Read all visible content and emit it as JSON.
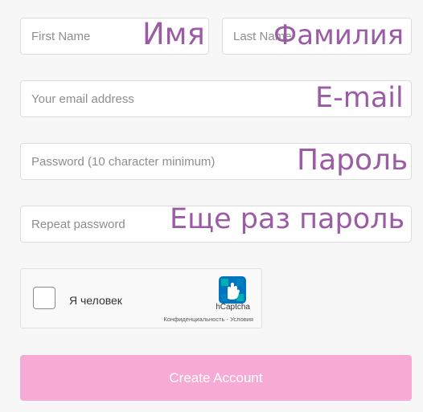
{
  "form": {
    "first_name": {
      "placeholder": "First Name",
      "value": ""
    },
    "last_name": {
      "placeholder": "Last Name",
      "value": ""
    },
    "email": {
      "placeholder": "Your email address",
      "value": ""
    },
    "password": {
      "placeholder": "Password (10 character minimum)",
      "value": ""
    },
    "repeat_password": {
      "placeholder": "Repeat password",
      "value": ""
    },
    "submit_label": "Create Account"
  },
  "annotations": {
    "first_name": "Имя",
    "last_name": "Фамилия",
    "email": "E-mail",
    "password": "Пароль",
    "repeat_password": "Еще раз пароль"
  },
  "captcha": {
    "checked": false,
    "label": "Я человек",
    "brand": "hCaptcha",
    "privacy_link": "Конфиденциальность",
    "separator": " - ",
    "terms_link": "Условия",
    "icon": "hcaptcha-hand-icon"
  },
  "colors": {
    "background": "#f7f7f7",
    "annotation": "#9b5ba5",
    "submit_button": "#f7aad4",
    "captcha_accent": "#0074bf",
    "captcha_accent_light": "#00bfae"
  }
}
